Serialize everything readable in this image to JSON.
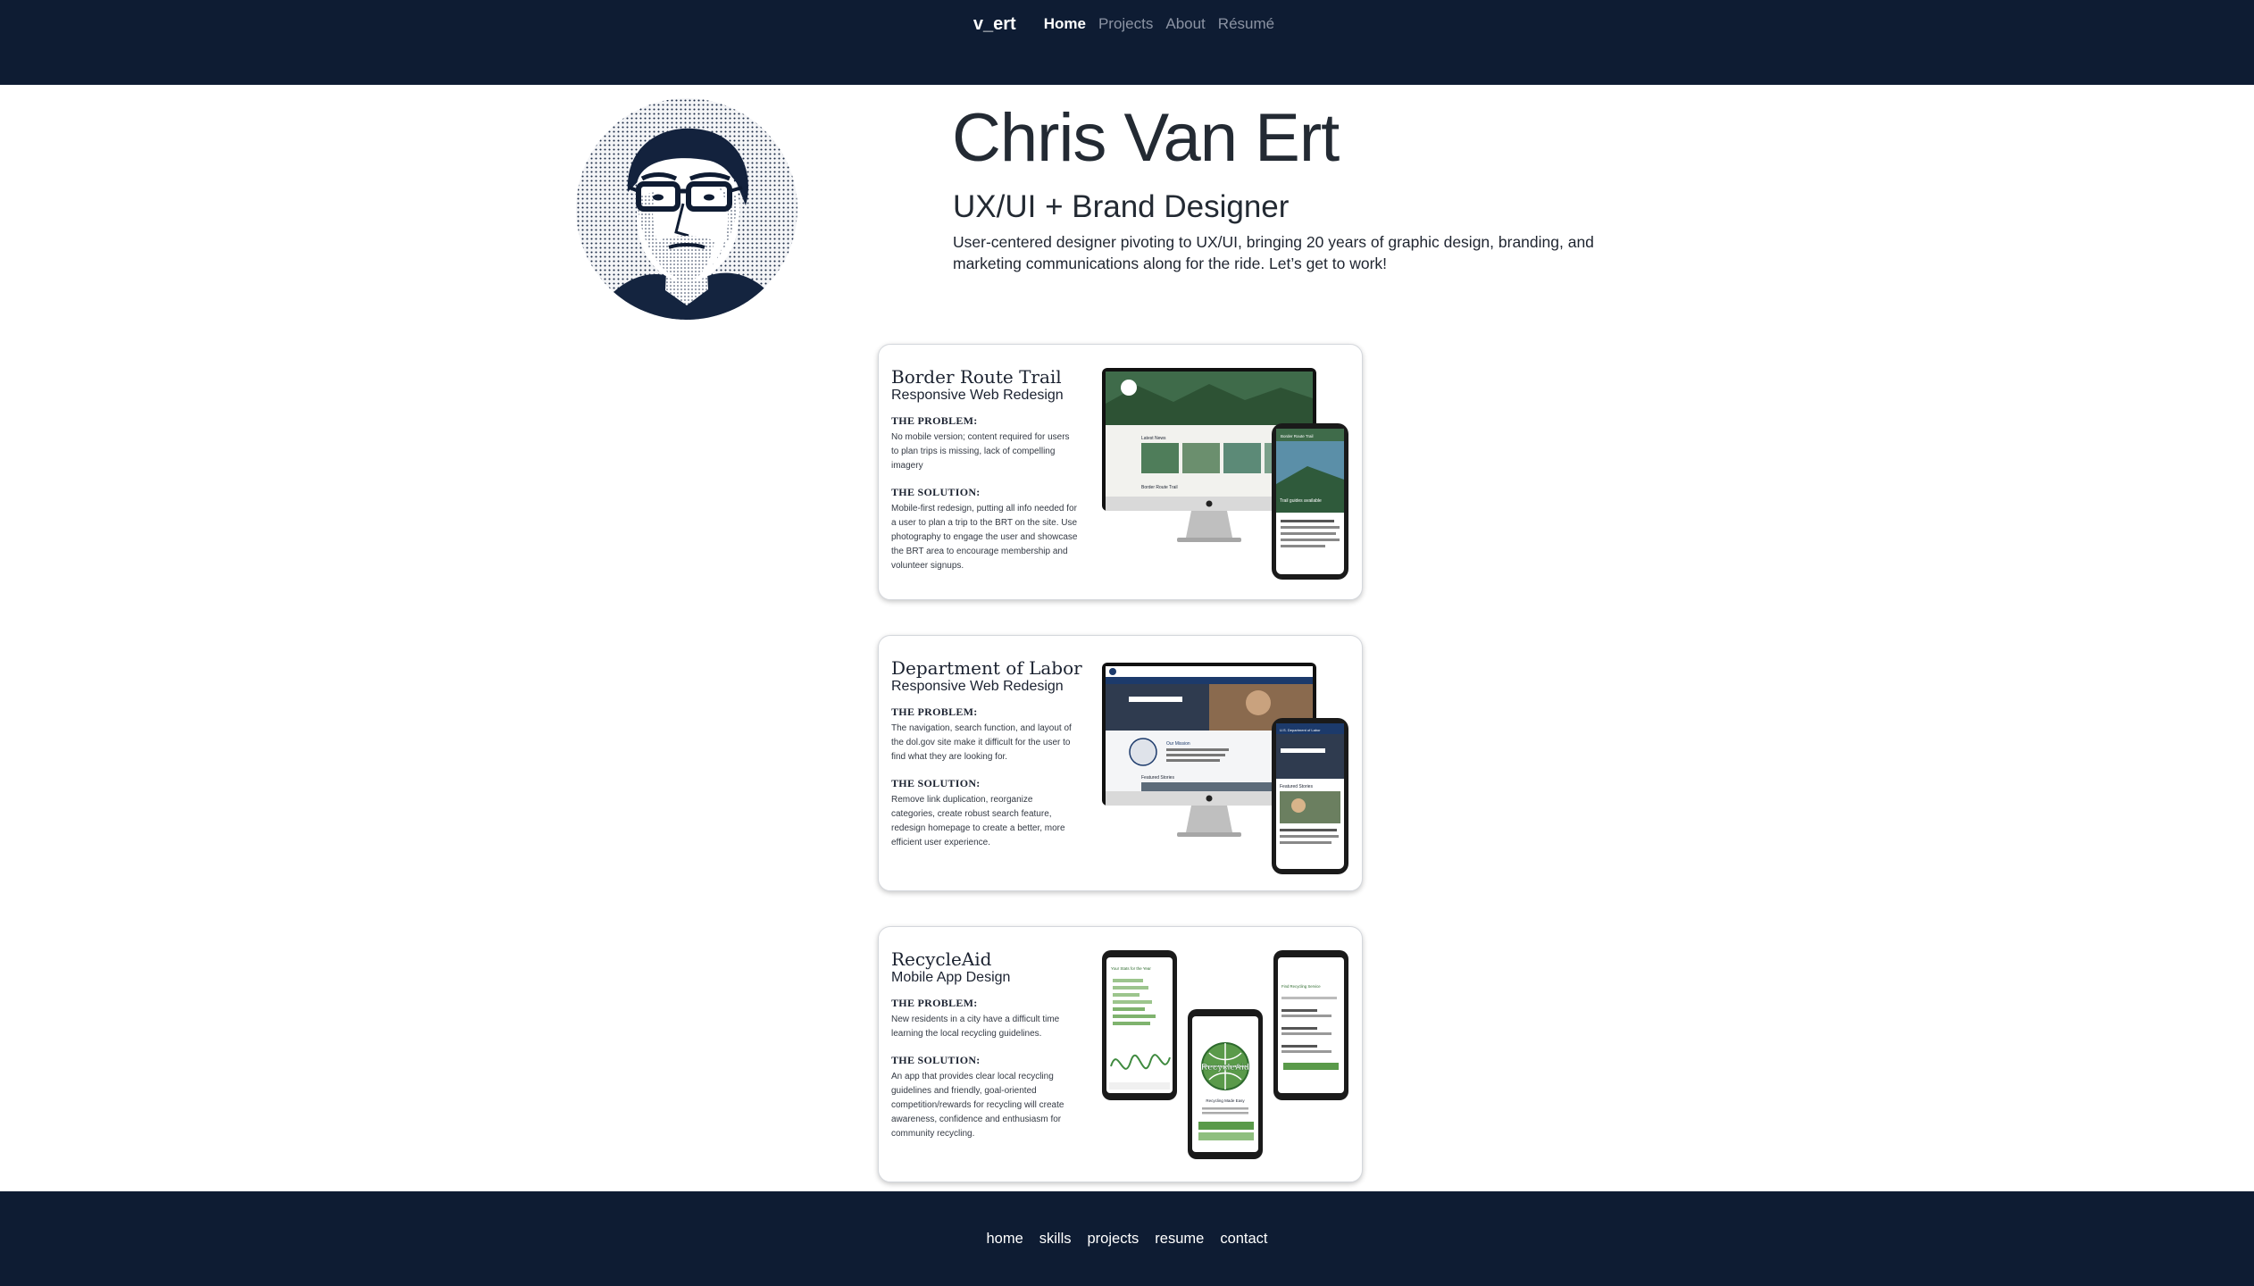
{
  "nav": {
    "brand": "v_ert",
    "links": [
      "Home",
      "Projects",
      "About",
      "Résumé"
    ],
    "active": "Home"
  },
  "hero": {
    "name": "Chris Van Ert",
    "role": "UX/UI + Brand Designer",
    "description": "User-centered designer pivoting to UX/UI, bringing 20 years of graphic design, branding, and marketing communications along for the ride. Let’s get to work!"
  },
  "projects": [
    {
      "title": "Border Route Trail",
      "subtitle": "Responsive Web Redesign",
      "problem_label": "THE PROBLEM:",
      "problem": "No mobile version; content required for users to plan trips is missing, lack of compelling imagery",
      "solution_label": "THE SOLUTION:",
      "solution": "Mobile-first redesign, putting all info needed for a user to plan a trip to the BRT on the site. Use photography to engage the user and showcase the BRT area to encourage membership and volunteer signups.",
      "mockup": {
        "desktop_heading": "Latest News",
        "desktop_footer": "Border Route Trail",
        "phone_header": "Border Route Trail",
        "phone_banner": "Trail guides available"
      }
    },
    {
      "title": "Department of Labor",
      "subtitle": "Responsive Web Redesign",
      "problem_label": "THE PROBLEM:",
      "problem": "The navigation, search function, and layout of the dol.gov site make it difficult for the user to find what they are looking for.",
      "solution_label": "THE SOLUTION:",
      "solution": "Remove link duplication, reorganize categories, create robust search feature, redesign homepage to create a better, more efficient user experience.",
      "mockup": {
        "desktop_heading": "Our Mission",
        "desktop_footer": "Featured Stories",
        "phone_header": "U.S. Department of Labor",
        "phone_banner": "Featured Stories"
      }
    },
    {
      "title": "RecycleAid",
      "subtitle": "Mobile App Design",
      "problem_label": "THE PROBLEM:",
      "problem": "New residents in a city have a difficult time learning the local recycling guidelines.",
      "solution_label": "THE SOLUTION:",
      "solution": "An app that provides clear local recycling guidelines and friendly, goal-oriented competition/rewards for recycling will create awareness, confidence and enthusiasm for community recycling.",
      "mockup": {
        "left_screen_title": "Your Stats for the Year",
        "center_logo": "RecycleAid",
        "center_caption": "Recycling Made Easy",
        "right_screen_title": "Find Recycling Service"
      }
    }
  ],
  "footer": {
    "links": [
      "home",
      "skills",
      "projects",
      "resume",
      "contact"
    ]
  },
  "colors": {
    "navy": "#0e1c33",
    "text": "#232a33",
    "muted_nav": "#8b93a3",
    "recycle_green": "#5a9a4a"
  }
}
